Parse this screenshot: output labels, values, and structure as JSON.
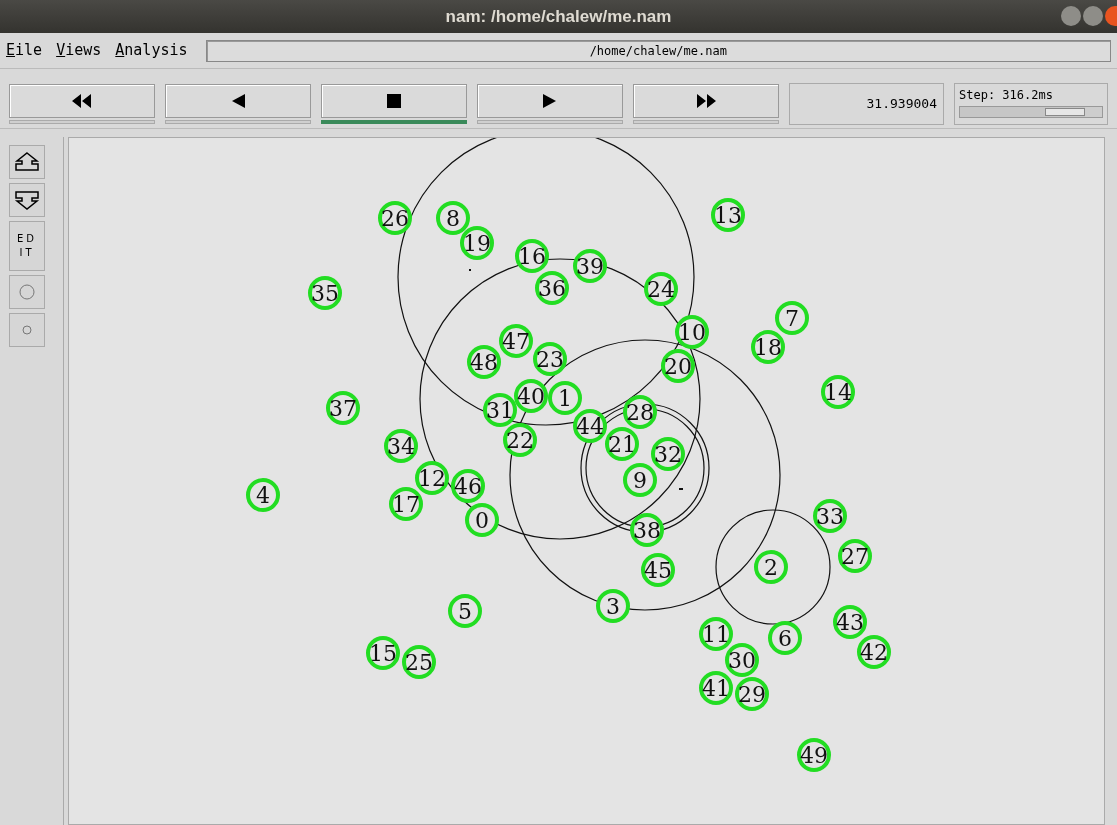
{
  "window": {
    "title": "nam: /home/chalew/me.nam"
  },
  "menu": [
    {
      "label": "Eile"
    },
    {
      "label": "Views"
    },
    {
      "label": "Analysis"
    }
  ],
  "file_field": {
    "value": "/home/chalew/me.nam"
  },
  "playback": [
    {
      "kind": "rewind",
      "selected": false
    },
    {
      "kind": "back",
      "selected": false
    },
    {
      "kind": "stop",
      "selected": true
    },
    {
      "kind": "play",
      "selected": false
    },
    {
      "kind": "forward",
      "selected": false
    }
  ],
  "time": "31.939004",
  "step": {
    "label": "Step: 316.2ms",
    "level": 0.88
  },
  "tools": [
    {
      "kind": "zoom_in"
    },
    {
      "kind": "zoom_out"
    },
    {
      "kind": "edit",
      "label": "ED IT"
    },
    {
      "kind": "big_circle"
    },
    {
      "kind": "small_circle"
    }
  ],
  "nodes": [
    "26",
    "8",
    "13",
    "19",
    "16",
    "39",
    "35",
    "36",
    "24",
    "47",
    "10",
    "18",
    "7",
    "48",
    "23",
    "20",
    "37",
    "31",
    "40",
    "1",
    "14",
    "22",
    "44",
    "21",
    "28",
    "34",
    "32",
    "9",
    "4",
    "17",
    "12",
    "46",
    "0",
    "38",
    "33",
    "45",
    "2",
    "27",
    "5",
    "3",
    "15",
    "25",
    "11",
    "30",
    "6",
    "43",
    "42",
    "41",
    "29",
    "49"
  ]
}
